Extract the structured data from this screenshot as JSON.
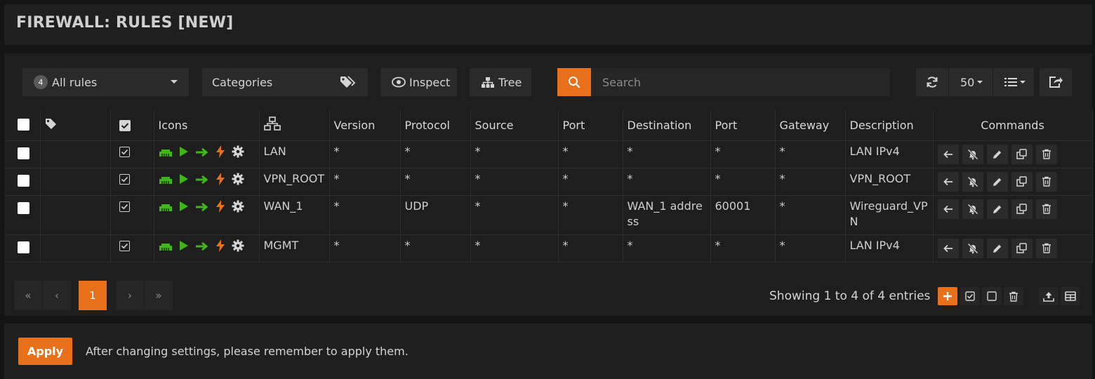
{
  "header": {
    "title": "FIREWALL: RULES [NEW]"
  },
  "toolbar": {
    "rules_count": "4",
    "rules_filter": "All rules",
    "categories": "Categories",
    "inspect": "Inspect",
    "tree": "Tree",
    "search_placeholder": "Search",
    "page_size": "50"
  },
  "columns": {
    "icons": "Icons",
    "version": "Version",
    "protocol": "Protocol",
    "source": "Source",
    "source_port": "Port",
    "destination": "Destination",
    "dest_port": "Port",
    "gateway": "Gateway",
    "description": "Description",
    "commands": "Commands"
  },
  "rows": [
    {
      "interface": "LAN",
      "version": "*",
      "protocol": "*",
      "source": "*",
      "source_port": "*",
      "destination": "*",
      "dest_port": "*",
      "gateway": "*",
      "description": "LAN IPv4"
    },
    {
      "interface": "VPN_ROOT",
      "version": "*",
      "protocol": "*",
      "source": "*",
      "source_port": "*",
      "destination": "*",
      "dest_port": "*",
      "gateway": "*",
      "description": "VPN_ROOT"
    },
    {
      "interface": "WAN_1",
      "version": "*",
      "protocol": "UDP",
      "source": "*",
      "source_port": "*",
      "destination": "WAN_1 address",
      "dest_port": "60001",
      "gateway": "*",
      "description": "Wireguard_VPN"
    },
    {
      "interface": "MGMT",
      "version": "*",
      "protocol": "*",
      "source": "*",
      "source_port": "*",
      "destination": "*",
      "dest_port": "*",
      "gateway": "*",
      "description": "LAN IPv4"
    }
  ],
  "pagination": {
    "first": "«",
    "prev": "‹",
    "current": "1",
    "next": "›",
    "last": "»"
  },
  "footer": {
    "info": "Showing 1 to 4 of 4 entries"
  },
  "apply": {
    "button": "Apply",
    "message": "After changing settings, please remember to apply them."
  },
  "colors": {
    "accent": "#e8701a",
    "pass_green": "#3fb618",
    "lightning": "#e8701a"
  },
  "icon_names": [
    "tag-icon",
    "checkbox-icon",
    "network-icon",
    "play-icon",
    "arrow-right-icon",
    "lightning-icon",
    "gear-icon",
    "refresh-icon",
    "list-icon",
    "export-icon",
    "eye-icon",
    "sitemap-icon",
    "search-icon"
  ]
}
